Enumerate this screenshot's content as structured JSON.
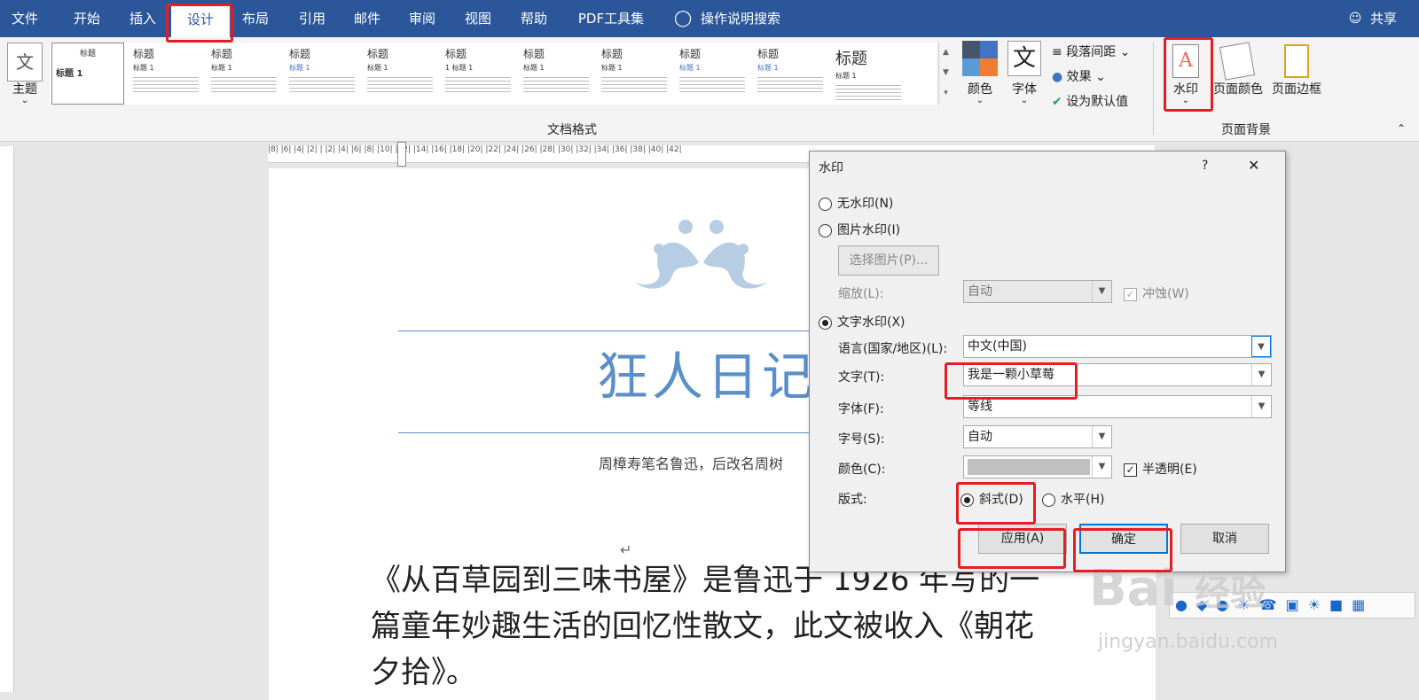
{
  "tabs": [
    "文件",
    "开始",
    "插入",
    "设计",
    "布局",
    "引用",
    "邮件",
    "审阅",
    "视图",
    "帮助",
    "PDF工具集"
  ],
  "search": {
    "label": "操作说明搜索"
  },
  "share": {
    "label": "共享"
  },
  "ribbon": {
    "theme_label": "主题",
    "theme_icon_text": "文",
    "colors_label": "颜色",
    "fonts_label": "字体",
    "fonts_icon_text": "文",
    "paragraph_spacing": "段落间距",
    "effects": "效果",
    "set_default": "设为默认值",
    "watermark_label": "水印",
    "page_color_label": "页面颜色",
    "page_border_label": "页面边框",
    "group_doc_format": "文档格式",
    "group_page_bg": "页面背景",
    "styles": [
      {
        "title": "标题",
        "sub": "标题 1"
      },
      {
        "title": "标题",
        "sub": "标题 1"
      },
      {
        "title": "标题",
        "sub": "标题 1"
      },
      {
        "title": "标题",
        "sub": "标题 1"
      },
      {
        "title": "标题",
        "sub": "标题 1"
      },
      {
        "title": "标题",
        "sub": "1 标题 1"
      },
      {
        "title": "标题",
        "sub": "标题 1"
      },
      {
        "title": "标题",
        "sub": "标题 1"
      },
      {
        "title": "标题",
        "sub": "标题 1"
      },
      {
        "title": "标题",
        "sub": "标题 1"
      },
      {
        "title": "标题",
        "sub": "标题 1"
      }
    ]
  },
  "ruler_text": "|8| |6| |4| |2| | |2| |4| |6| |8| |10| |12| |14| |16| |18| |20| |22| |24| |26| |28| |30| |32| |34| |36| |38| |40| |42|",
  "document": {
    "title": "狂人日记",
    "subtitle": "周樟寿笔名鲁迅，后改名周树",
    "body_line1": "《从百草园到三味书屋》是鲁迅于 1926 年写的一",
    "body_line2": "篇童年妙趣生活的回忆性散文，此文被收入《朝花",
    "body_line3": "夕拾》。",
    "para_mark": "↵"
  },
  "dialog": {
    "title": "水印",
    "help": "?",
    "close": "✕",
    "no_watermark": "无水印(N)",
    "picture_watermark": "图片水印(I)",
    "select_picture": "选择图片(P)...",
    "scale_label": "缩放(L):",
    "scale_value": "自动",
    "washout": "冲蚀(W)",
    "text_watermark": "文字水印(X)",
    "language_label": "语言(国家/地区)(L):",
    "language_value": "中文(中国)",
    "text_label": "文字(T):",
    "text_value": "我是一颗小草莓",
    "font_label": "字体(F):",
    "font_value": "等线",
    "size_label": "字号(S):",
    "size_value": "自动",
    "color_label": "颜色(C):",
    "semitransparent": "半透明(E)",
    "layout_label": "版式:",
    "diagonal": "斜式(D)",
    "horizontal": "水平(H)",
    "apply": "应用(A)",
    "ok": "确定",
    "cancel": "取消"
  },
  "watermark_brand": {
    "line1": "Bai",
    "line2": "经验",
    "url": "jingyan.baidu.com"
  },
  "colors": {
    "word_blue": "#2b579a",
    "highlight_red": "#e31e24",
    "title_blue": "#5b8fc7"
  }
}
